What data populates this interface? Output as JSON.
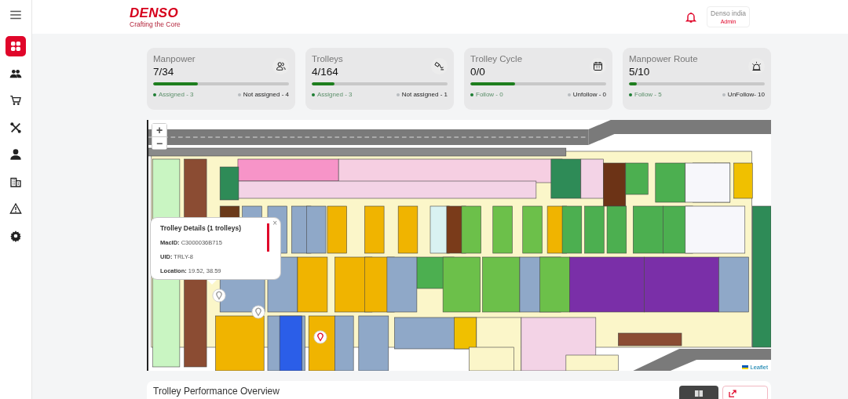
{
  "header": {
    "brand": "DENSO",
    "tagline": "Crafting the Core",
    "user": {
      "name": "Denso india",
      "role": "Admin"
    }
  },
  "sidebar": {
    "items": [
      {
        "selected": true
      },
      {
        "selected": false
      },
      {
        "selected": false
      },
      {
        "selected": false
      },
      {
        "selected": false
      },
      {
        "selected": false
      },
      {
        "selected": false
      },
      {
        "selected": false
      }
    ]
  },
  "cards": [
    {
      "title": "Manpower",
      "value": "7/34",
      "level": 0.33,
      "legend": [
        {
          "label": "Assigned - 3",
          "color": "#1e7e34"
        },
        {
          "label": "Not assigned - 4",
          "color": "#b8bcc0"
        }
      ]
    },
    {
      "title": "Trolleys",
      "value": "4/164",
      "level": 0.17,
      "legend": [
        {
          "label": "Assigned - 3",
          "color": "#1e7e34"
        },
        {
          "label": "Not assigned - 1",
          "color": "#b8bcc0"
        }
      ]
    },
    {
      "title": "Trolley Cycle",
      "value": "0/0",
      "level": 0.33,
      "legend": [
        {
          "label": "Follow - 0",
          "color": "#1e7e34"
        },
        {
          "label": "Unfollow - 0",
          "color": "#b8bcc0"
        }
      ]
    },
    {
      "title": "Manpower Route",
      "value": "5/10",
      "level": 0.06,
      "legend": [
        {
          "label": "Follow - 5",
          "color": "#1e7e34"
        },
        {
          "label": "UnFollow- 10",
          "color": "#b8bcc0"
        }
      ]
    }
  ],
  "map": {
    "zoom_in": "+",
    "zoom_out": "−",
    "attribution": "Leaflet",
    "popup": {
      "title": "Trolley Details (1 trolleys)",
      "close": "×",
      "lines": [
        "**MacID:** C3000036B715",
        "**UID:** TRLY-8",
        "**Location:** 19.52, 38.59"
      ]
    }
  },
  "performance": {
    "title": "Trolley Performance Overview"
  }
}
